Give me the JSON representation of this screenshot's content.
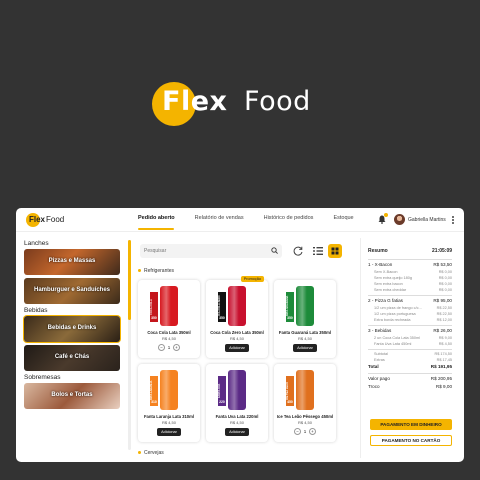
{
  "brand": {
    "name_bold": "Flex",
    "name_light": "Food",
    "accent": "#F4B400",
    "background": "#333333"
  },
  "topbar": {
    "nav": [
      "Pedido aberto",
      "Relatório de vendas",
      "Histórico de pedidos",
      "Estoque"
    ],
    "active_nav": "Pedido aberto",
    "user_name": "Gabriella Martins",
    "icons": [
      "bell-icon",
      "kebab-menu-icon"
    ]
  },
  "sidebar": {
    "sections": [
      {
        "title": "Lanches",
        "items": [
          {
            "label": "Pizzas e Massas",
            "selected": false
          },
          {
            "label": "Hamburguer e Sanduíches",
            "selected": false
          }
        ]
      },
      {
        "title": "Bebidas",
        "items": [
          {
            "label": "Bebidas e Drinks",
            "selected": true
          },
          {
            "label": "Café e Chás",
            "selected": false
          }
        ]
      },
      {
        "title": "Sobremesas",
        "items": [
          {
            "label": "Bolos e Tortas",
            "selected": false
          }
        ]
      }
    ]
  },
  "main": {
    "search_placeholder": "Pesquisar",
    "subcategory": "Refrigerantes",
    "next_subcategory": "Cervejas",
    "products": [
      {
        "name": "Coca Cola Lata 350ml",
        "price": "R$ 4,50",
        "can_color": "#d71920",
        "label_color": "#c4161c",
        "label_text": "COCA-COLA",
        "size": "350",
        "qty": "1",
        "control": "stepper",
        "promo": ""
      },
      {
        "name": "Coca Cola Zero Lata 350ml",
        "price": "R$ 4,50",
        "can_color": "#c8102e",
        "label_color": "#111111",
        "label_text": "COCA-COLA ZERO",
        "size": "350",
        "qty": "",
        "control": "add",
        "promo": "Promoção"
      },
      {
        "name": "Fanta Guaraná Lata 350ml",
        "price": "R$ 4,50",
        "can_color": "#1d8b3a",
        "label_color": "#1d8b3a",
        "label_text": "FANTA GUARANÁ",
        "size": "350",
        "qty": "",
        "control": "add",
        "promo": ""
      },
      {
        "name": "Fanta Laranja Lata 310ml",
        "price": "R$ 4,50",
        "can_color": "#f58220",
        "label_color": "#f58220",
        "label_text": "FANTA LARANJA",
        "size": "310",
        "qty": "",
        "control": "add",
        "promo": ""
      },
      {
        "name": "Fanta Uva Lata 220ml",
        "price": "R$ 4,50",
        "can_color": "#5b2a86",
        "label_color": "#5b2a86",
        "label_text": "FANTA UVA",
        "size": "220",
        "qty": "",
        "control": "add",
        "promo": ""
      },
      {
        "name": "Ice Tea Leão Pêssego 450ml",
        "price": "R$ 4,50",
        "can_color": "#e0701e",
        "label_color": "#e0701e",
        "label_text": "ICE TEA LEÃO",
        "size": "450",
        "qty": "1",
        "control": "stepper",
        "promo": ""
      }
    ],
    "add_label": "Adicionar"
  },
  "summary": {
    "title": "Resumo",
    "time": "21:05:09",
    "lines": [
      {
        "label": "1 - X-Bacon",
        "value": "R$ 53,50",
        "type": "item"
      },
      {
        "label": "Sem X-Bacon",
        "value": "R$ 0,00",
        "type": "sub"
      },
      {
        "label": "Sem extra queijo 180g",
        "value": "R$ 0,00",
        "type": "sub"
      },
      {
        "label": "Sem extra bacon",
        "value": "R$ 0,00",
        "type": "sub"
      },
      {
        "label": "Sem extra cheddar",
        "value": "R$ 0,00",
        "type": "sub"
      },
      {
        "label": "2 - Pizza G fatias",
        "value": "R$ 95,00",
        "type": "item"
      },
      {
        "label": "1/2 um pizza de frango c/c...",
        "value": "R$ 22,50",
        "type": "sub"
      },
      {
        "label": "1/2 um pizza portuguesa",
        "value": "R$ 22,50",
        "type": "sub"
      },
      {
        "label": "Extra borda recheada",
        "value": "R$ 12,00",
        "type": "sub"
      },
      {
        "label": "3 - Bebidas",
        "value": "R$ 26,00",
        "type": "item"
      },
      {
        "label": "2 un Coca Cola Lata 350ml",
        "value": "R$ 9,00",
        "type": "sub"
      },
      {
        "label": "Fanta Uva Lata 450ml",
        "value": "R$ 4,50",
        "type": "sub"
      }
    ],
    "totals": [
      {
        "label": "Subtotal",
        "value": "R$ 174,50",
        "type": "sub"
      },
      {
        "label": "Extras",
        "value": "R$ 17,45",
        "type": "sub"
      },
      {
        "label": "Total",
        "value": "R$ 191,95",
        "type": "bold"
      }
    ],
    "payment": [
      {
        "label": "Valor pago",
        "value": "R$ 200,95",
        "type": "item"
      },
      {
        "label": "Troco",
        "value": "R$ 9,00",
        "type": "item"
      }
    ],
    "btn_cash": "PAGAMENTO EM DINHEIRO",
    "btn_card": "PAGAMENTO NO CARTÃO"
  }
}
